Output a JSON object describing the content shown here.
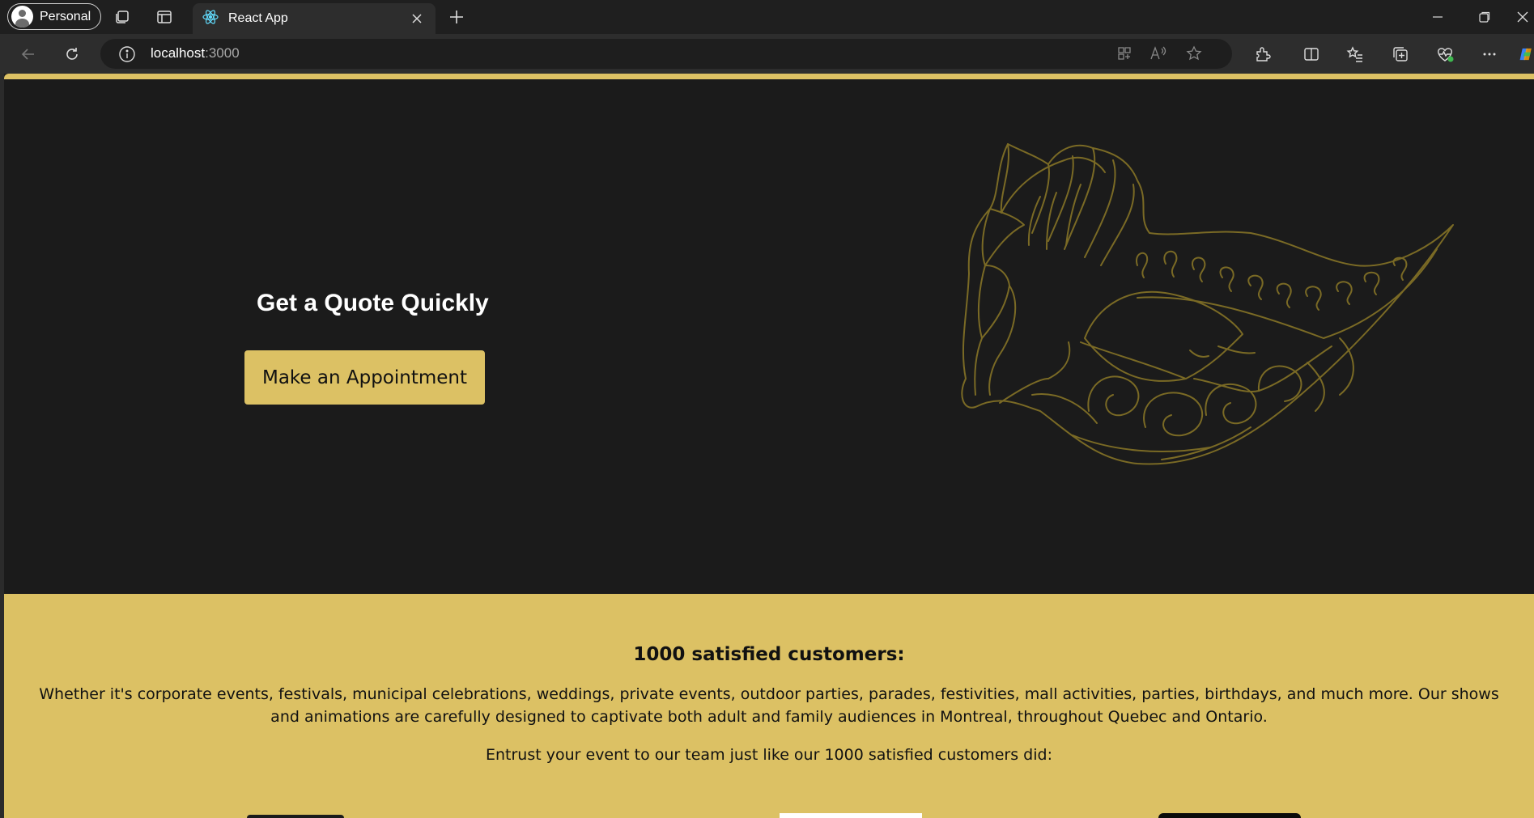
{
  "browser": {
    "profile_label": "Personal",
    "tab_title": "React App",
    "address_host": "localhost",
    "address_port": ":3000"
  },
  "hero": {
    "title": "Get a Quote Quickly",
    "cta_label": "Make an Appointment"
  },
  "customers": {
    "heading": "1000 satisfied customers:",
    "description": "Whether it's corporate events, festivals, municipal celebrations, weddings, private events, outdoor parties, parades, festivities, mall activities, parties, birthdays, and much more. Our shows and animations are carefully designed to captivate both adult and family audiences in Montreal, throughout Quebec and Ontario.",
    "entrust": "Entrust your event to our team just like our 1000 satisfied customers did:"
  },
  "colors": {
    "accent": "#dcc164",
    "background": "#1b1b1b",
    "mask_line": "#7a6a25"
  },
  "icons": [
    "workspaces-icon",
    "tab-actions-icon",
    "react-icon",
    "close-icon",
    "new-tab-icon",
    "minimize-icon",
    "restore-icon",
    "back-icon",
    "refresh-icon",
    "info-icon",
    "app-available-icon",
    "read-aloud-icon",
    "favorite-star-icon",
    "extensions-icon",
    "split-screen-icon",
    "favorites-icon",
    "collections-icon",
    "browser-essentials-icon",
    "more-icon",
    "copilot-icon"
  ]
}
